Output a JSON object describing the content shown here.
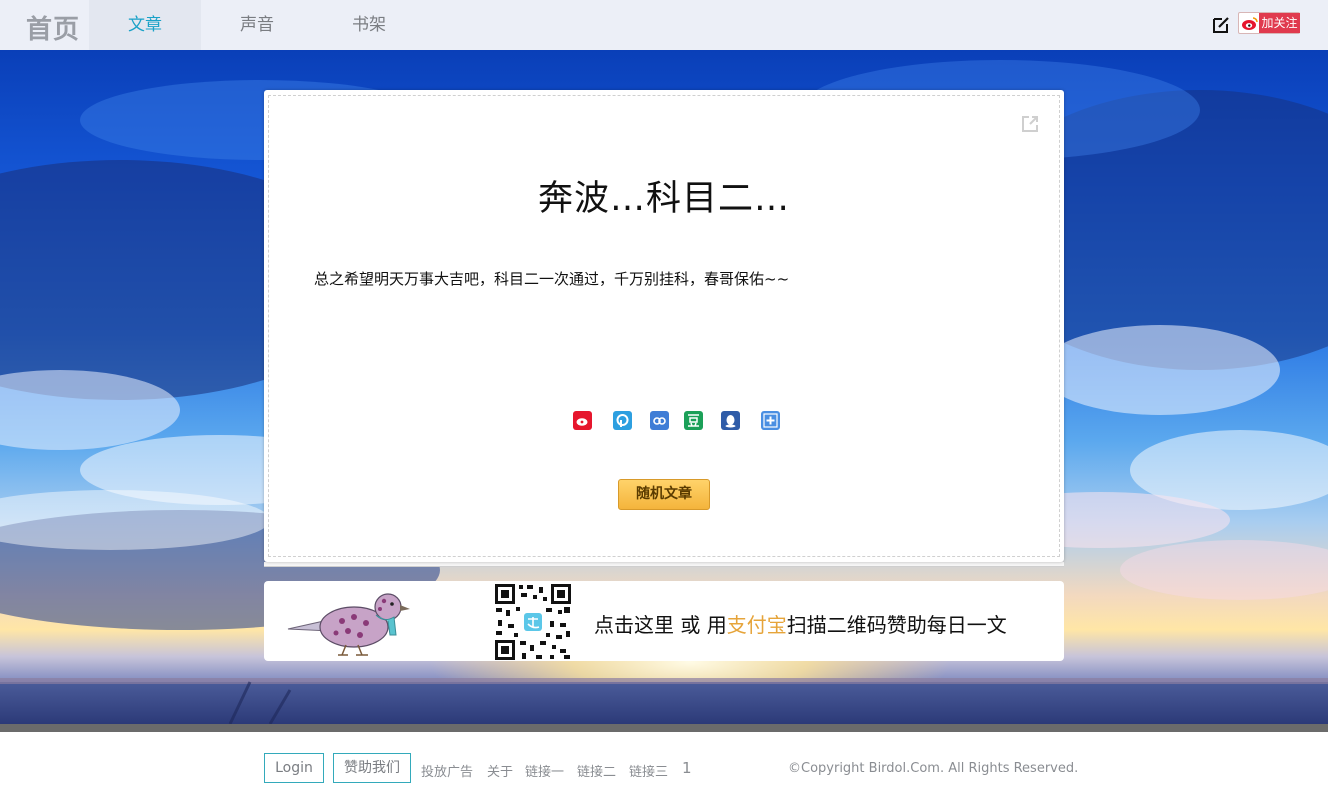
{
  "nav": {
    "home": "首页",
    "tabs": [
      {
        "label": "文章",
        "active": true
      },
      {
        "label": "声音",
        "active": false
      },
      {
        "label": "书架",
        "active": false
      }
    ],
    "edit_icon": "edit-icon",
    "follow_label": "加关注"
  },
  "article": {
    "title": "奔波…科目二…",
    "body": "总之希望明天万事大吉吧，科目二一次通过，千万别挂科，春哥保佑~~",
    "share_icons": [
      "weibo-icon",
      "pengyou-icon",
      "renren-icon",
      "douban-icon",
      "qq-icon",
      "more-icon"
    ],
    "random_button": "随机文章"
  },
  "donate": {
    "text_prefix": "点击这里 或 用",
    "alipay": "支付宝",
    "text_suffix": "扫描二维码赞助每日一文"
  },
  "footer": {
    "login": "Login",
    "sponsor": "赞助我们",
    "links": [
      "投放广告",
      "关于",
      "链接一",
      "链接二",
      "链接三"
    ],
    "number": "1",
    "copyright": "©Copyright Birdol.Com. All Rights Reserved."
  },
  "colors": {
    "accent": "#1aa2c8",
    "follow_red": "#e03a4e",
    "button_orange": "#f4b43c",
    "alipay_gold": "#e6a43a"
  }
}
